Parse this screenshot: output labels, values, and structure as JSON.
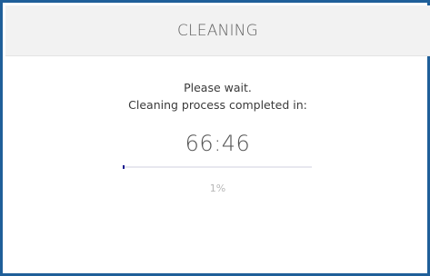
{
  "dialog": {
    "title": "CLEANING",
    "message_line1": "Please wait.",
    "message_line2": "Cleaning process completed in:",
    "timer": "66:46",
    "progress": {
      "value": 0.01,
      "label": "1%"
    }
  },
  "colors": {
    "border": "#1f5f99",
    "header_bg": "#f2f2f2",
    "progress_fill": "#1b1b8f",
    "progress_track": "#e7e7ef"
  }
}
